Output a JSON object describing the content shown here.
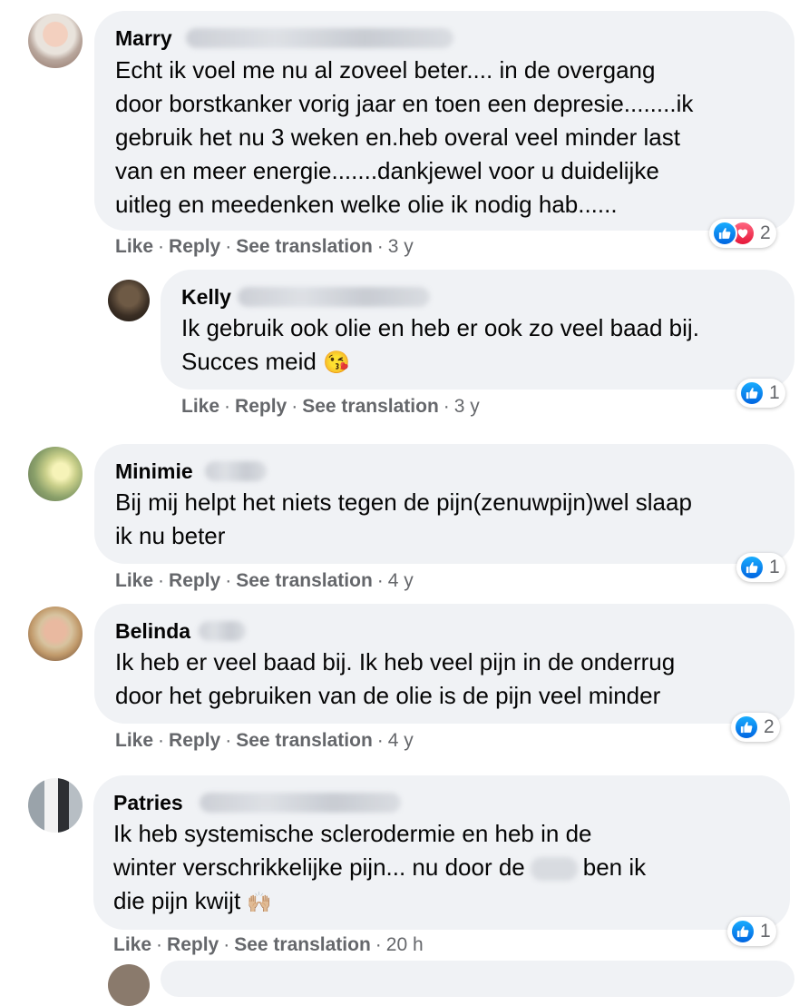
{
  "comments": [
    {
      "name": "Marry",
      "text": "Echt ik voel me nu al zoveel beter.... in de overgang\ndoor borstkanker vorig jaar en toen een depresie........ik\ngebruik het nu 3 weken en.heb overal veel minder last\nvan en meer energie.......dankjewel voor u duidelijke\nuitleg en meedenken welke olie ik nodig hab......",
      "like": "Like",
      "reply": "Reply",
      "translate": "See translation",
      "time": "3 y",
      "reaction_count": "2"
    },
    {
      "name": "Kelly",
      "text": "Ik gebruik ook olie en heb er ook zo veel baad bij.\nSucces meid",
      "emoji": "😘",
      "like": "Like",
      "reply": "Reply",
      "translate": "See translation",
      "time": "3 y",
      "reaction_count": "1"
    },
    {
      "name": "Minimie",
      "text": "Bij mij helpt het niets tegen de pijn(zenuwpijn)wel slaap\nik nu beter",
      "like": "Like",
      "reply": "Reply",
      "translate": "See translation",
      "time": "4 y",
      "reaction_count": "1"
    },
    {
      "name": "Belinda",
      "text": "Ik heb er veel baad bij. Ik heb veel pijn in de onderrug\ndoor het gebruiken van de olie is de pijn veel minder",
      "like": "Like",
      "reply": "Reply",
      "translate": "See translation",
      "time": "4 y",
      "reaction_count": "2"
    },
    {
      "name": "Patries",
      "text_line1": "Ik heb systemische sclerodermie en heb in de",
      "text_line2a": "winter verschrikkelijke pijn... nu door de",
      "text_line2b": "ben ik",
      "text_line3": "die pijn kwijt",
      "emoji": "🙌🏼",
      "like": "Like",
      "reply": "Reply",
      "translate": "See translation",
      "time": "20 h",
      "reaction_count": "1"
    }
  ],
  "colors": {
    "bubble": "#f0f2f5",
    "meta": "#65676b",
    "like_blue": "#1877f2",
    "love_red": "#f33e58"
  },
  "icons": [
    "like-reaction-icon",
    "love-reaction-icon"
  ]
}
